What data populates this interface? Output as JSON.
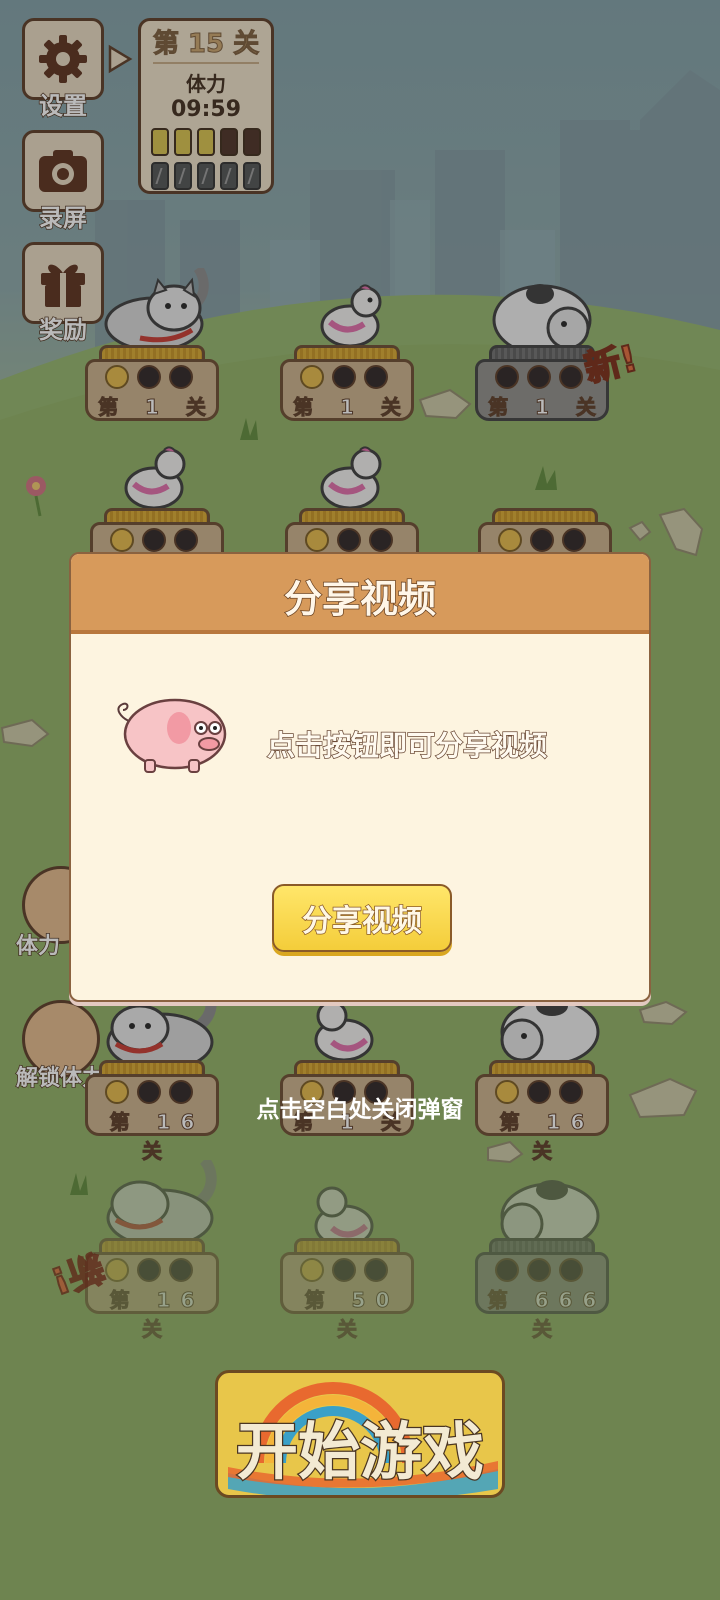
{
  "level_panel": {
    "title": "第 15 关",
    "stamina_label": "体力",
    "timer": "09:59",
    "bars_total": 5,
    "bars_full": 3
  },
  "side_buttons": [
    {
      "label": "设置",
      "icon": "gear-icon"
    },
    {
      "label": "录屏",
      "icon": "camera-icon"
    },
    {
      "label": "奖励",
      "icon": "gift-icon"
    }
  ],
  "side_labels_lower": [
    "体力",
    "解锁体力"
  ],
  "new_badge": "新!",
  "level_cards": [
    {
      "animal": "cat",
      "label": "第 1 关",
      "coins": 1
    },
    {
      "animal": "chicken",
      "label": "第 1 关",
      "coins": 1
    },
    {
      "animal": "cow",
      "label": "第 1 关",
      "coins": 0,
      "locked": true
    },
    {
      "animal": "chicken",
      "label": "",
      "coins": 1
    },
    {
      "animal": "chicken",
      "label": "",
      "coins": 1
    },
    {
      "animal": "none",
      "label": "",
      "coins": 1
    },
    {
      "animal": "cat",
      "label": "第 16 关",
      "coins": 1
    },
    {
      "animal": "chicken",
      "label": "第 1 关",
      "coins": 1
    },
    {
      "animal": "cow",
      "label": "第 16 关",
      "coins": 1
    },
    {
      "animal": "cat",
      "label": "第 16 关",
      "coins": 1
    },
    {
      "animal": "chicken",
      "label": "第 50 关",
      "coins": 1
    },
    {
      "animal": "cow",
      "label": "第 666 关",
      "coins": 0,
      "locked": true
    }
  ],
  "dialog": {
    "title": "分享视频",
    "message": "点击按钮即可分享视频",
    "button_label": "分享视频"
  },
  "close_hint": "点击空白处关闭弹窗",
  "start_button": "开始游戏",
  "colors": {
    "dialog_header": "#d79a5b",
    "dialog_body": "#fdf4e0",
    "button_yellow": "#f4cd3a",
    "brown_outline": "#5a3a24"
  }
}
